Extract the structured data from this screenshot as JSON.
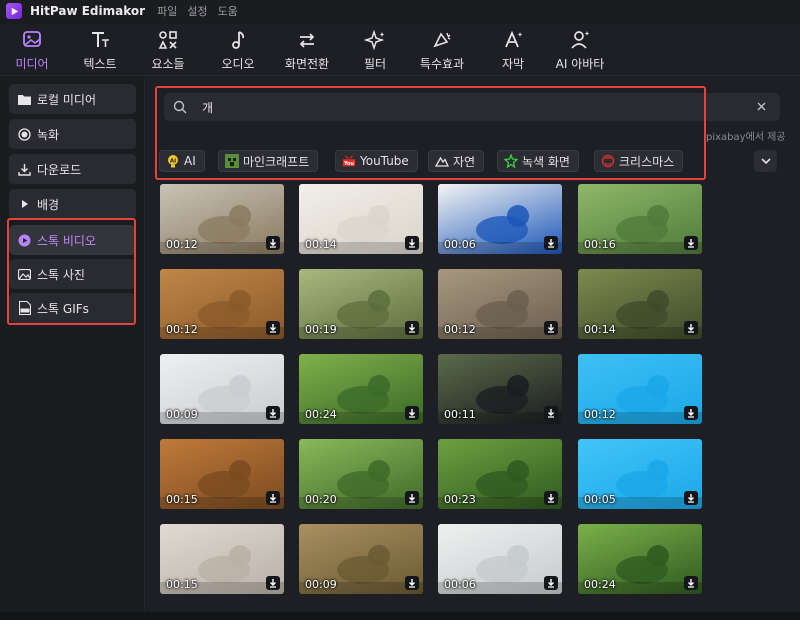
{
  "app": {
    "title": "HitPaw Edimakor",
    "menu": [
      "파일",
      "설정",
      "도움"
    ]
  },
  "toolbar": {
    "items": [
      {
        "label": "미디어",
        "icon": "media-icon",
        "active": true
      },
      {
        "label": "텍스트",
        "icon": "text-icon"
      },
      {
        "label": "요소들",
        "icon": "elements-icon"
      },
      {
        "label": "오디오",
        "icon": "audio-icon"
      },
      {
        "label": "화면전환",
        "icon": "transition-icon"
      },
      {
        "label": "필터",
        "icon": "filter-icon"
      },
      {
        "label": "특수효과",
        "icon": "effects-icon"
      },
      {
        "label": "자막",
        "icon": "subtitle-icon"
      },
      {
        "label": "AI 아바타",
        "icon": "ai-avatar-icon"
      }
    ]
  },
  "sidebar": {
    "items": [
      {
        "label": "로컬 미디어",
        "icon": "folder-icon"
      },
      {
        "label": "녹화",
        "icon": "record-icon"
      },
      {
        "label": "다운로드",
        "icon": "download-icon"
      },
      {
        "label": "배경",
        "icon": "expand-arrow-icon"
      },
      {
        "label": "스톡 비디오",
        "icon": "stock-video-icon",
        "active": true
      },
      {
        "label": "스톡 사진",
        "icon": "stock-photo-icon"
      },
      {
        "label": "스톡 GIFs",
        "icon": "gif-file-icon"
      }
    ]
  },
  "search": {
    "value": "개",
    "provider_note": "pixabay에서 제공"
  },
  "chips": [
    {
      "label": "AI",
      "icon": "ai-bulb-icon"
    },
    {
      "label": "마인크래프트",
      "icon": "minecraft-icon"
    },
    {
      "label": "YouTube",
      "icon": "youtube-icon"
    },
    {
      "label": "자연",
      "icon": "nature-icon"
    },
    {
      "label": "녹색 화면",
      "icon": "green-screen-icon"
    },
    {
      "label": "크리스마스",
      "icon": "christmas-icon"
    }
  ],
  "videos": [
    {
      "duration": "00:12"
    },
    {
      "duration": "00:14"
    },
    {
      "duration": "00:06"
    },
    {
      "duration": "00:16"
    },
    {
      "duration": "00:12"
    },
    {
      "duration": "00:19"
    },
    {
      "duration": "00:12"
    },
    {
      "duration": "00:14"
    },
    {
      "duration": "00:09"
    },
    {
      "duration": "00:24"
    },
    {
      "duration": "00:11"
    },
    {
      "duration": "00:12"
    },
    {
      "duration": "00:15"
    },
    {
      "duration": "00:20"
    },
    {
      "duration": "00:23"
    },
    {
      "duration": "00:05"
    },
    {
      "duration": "00:15"
    },
    {
      "duration": "00:09"
    },
    {
      "duration": "00:06"
    },
    {
      "duration": "00:24"
    }
  ],
  "colors": {
    "accent": "#b883ff",
    "highlight_box": "#e0443a",
    "background": "#1b1c20"
  }
}
